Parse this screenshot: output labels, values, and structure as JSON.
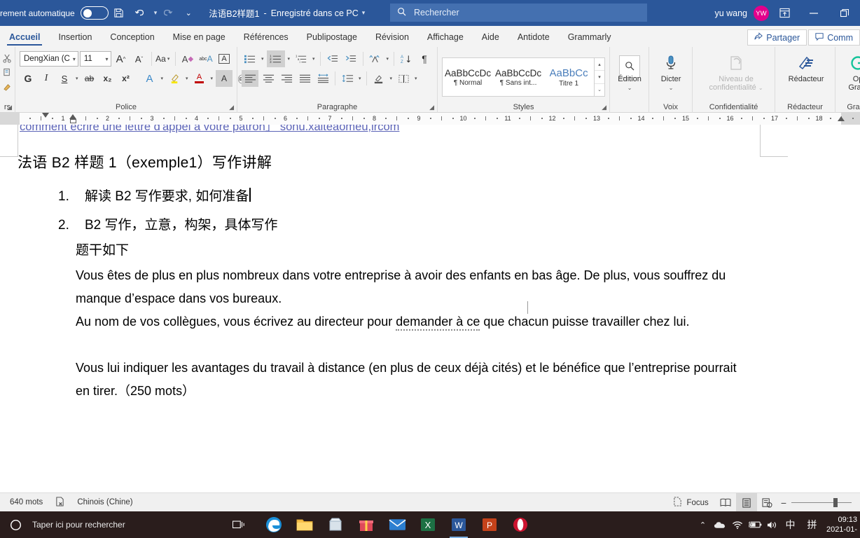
{
  "titlebar": {
    "autosave_label": "rement automatique",
    "autosave_state": "off",
    "save_icon": "save-icon",
    "undo_icon": "undo-icon",
    "redo_icon": "redo-icon",
    "customize_icon": "chevron-down-icon",
    "document_title": "法语B2样题1",
    "save_status": "Enregistré dans ce PC",
    "title_caret": "chevron-down-icon",
    "search_placeholder": "Rechercher",
    "search_icon": "search-icon",
    "user_name": "yu wang",
    "avatar_initials": "YW",
    "ribbon_display_icon": "ribbon-display-options-icon",
    "minimize_icon": "minimize-icon",
    "restore_icon": "restore-icon"
  },
  "tabs": [
    {
      "label": "Accueil",
      "active": true
    },
    {
      "label": "Insertion",
      "active": false
    },
    {
      "label": "Conception",
      "active": false
    },
    {
      "label": "Mise en page",
      "active": false
    },
    {
      "label": "Références",
      "active": false
    },
    {
      "label": "Publipostage",
      "active": false
    },
    {
      "label": "Révision",
      "active": false
    },
    {
      "label": "Affichage",
      "active": false
    },
    {
      "label": "Aide",
      "active": false
    },
    {
      "label": "Antidote",
      "active": false
    },
    {
      "label": "Grammarly",
      "active": false
    }
  ],
  "tab_actions": {
    "share_label": "Partager",
    "share_icon": "share-icon",
    "comments_label": "Comm",
    "comments_icon": "comment-icon"
  },
  "ribbon": {
    "clipboard": {
      "group_label": "rs",
      "launcher_icon": "dialog-launcher-icon",
      "cut_icon": "scissors-icon",
      "copy_icon": "copy-icon",
      "format_painter_icon": "format-painter-icon"
    },
    "font": {
      "group_label": "Police",
      "launcher_icon": "dialog-launcher-icon",
      "font_name": "DengXian (C",
      "font_size": "11",
      "grow_font_icon": "grow-font-icon",
      "shrink_font_icon": "shrink-font-icon",
      "change_case_label": "Aa",
      "clear_format_icon": "clear-formatting-icon",
      "phonetic_icon": "phonetic-guide-icon",
      "char_border_icon": "character-border-icon",
      "bold_label": "G",
      "italic_label": "I",
      "underline_label": "S",
      "strikethrough_label": "ab",
      "subscript_label": "x₂",
      "superscript_label": "x²",
      "text_effects_icon": "text-effects-icon",
      "highlight_icon": "highlight-icon",
      "font_color_icon": "font-color-icon",
      "char_shading_icon": "character-shading-icon",
      "enclose_char_icon": "enclose-character-icon"
    },
    "paragraph": {
      "group_label": "Paragraphe",
      "launcher_icon": "dialog-launcher-icon",
      "bullets_icon": "bullet-list-icon",
      "numbering_icon": "numbered-list-icon",
      "multilevel_icon": "multilevel-list-icon",
      "decrease_indent_icon": "decrease-indent-icon",
      "increase_indent_icon": "increase-indent-icon",
      "sort_cn_icon": "sort-phonetic-icon",
      "sort_icon": "sort-az-icon",
      "show_marks_icon": "pilcrow-icon",
      "align_left_icon": "align-left-icon",
      "align_center_icon": "align-center-icon",
      "align_right_icon": "align-right-icon",
      "justify_icon": "align-justify-icon",
      "distribute_icon": "distribute-text-icon",
      "line_spacing_icon": "line-spacing-icon",
      "shading_icon": "shading-icon",
      "borders_icon": "borders-icon"
    },
    "styles": {
      "group_label": "Styles",
      "launcher_icon": "dialog-launcher-icon",
      "items": [
        {
          "preview": "AaBbCcDc",
          "name": "¶ Normal"
        },
        {
          "preview": "AaBbCcDc",
          "name": "¶ Sans int..."
        },
        {
          "preview": "AaBbCc",
          "name": "Titre 1"
        }
      ],
      "scroll_up_icon": "chevron-up-icon",
      "scroll_down_icon": "chevron-down-icon",
      "more_icon": "styles-more-icon"
    },
    "editing": {
      "label": "Édition",
      "icon": "search-icon",
      "caret": "chevron-down-icon"
    },
    "voice": {
      "group_label": "Voix",
      "dictate_label": "Dicter",
      "dictate_icon": "microphone-icon",
      "caret": "chevron-down-icon"
    },
    "sensitivity": {
      "group_label": "Confidentialité",
      "label_line1": "Niveau de",
      "label_line2": "confidentialité",
      "icon": "sensitivity-label-icon",
      "disabled": true
    },
    "editor": {
      "group_label": "Rédacteur",
      "label": "Rédacteur",
      "icon": "editor-pen-icon"
    },
    "grammarly": {
      "group_label": "Gram",
      "label_line1": "Op",
      "label_line2": "Gram",
      "icon": "grammarly-icon"
    }
  },
  "ruler": {
    "unit_marks": [
      "1",
      "2",
      "3",
      "4",
      "5",
      "6",
      "7",
      "8",
      "9",
      "10",
      "11",
      "12",
      "13",
      "14",
      "15",
      "16",
      "17",
      "18"
    ],
    "left_indent_marker": "first-line-indent-marker",
    "right_indent_marker": "right-indent-marker"
  },
  "document": {
    "clipped_header_text": "comment écrire une lettre d'appel à votre patron」 sohu.xaiteaomeu,ircom",
    "title": "法语 B2 样题 1（exemple1）写作讲解",
    "list": [
      {
        "num": "1.",
        "text": "解读 B2 写作要求, 如何准备",
        "has_caret": true
      },
      {
        "num": "2.",
        "text": "B2 写作，立意，构架，具体写作",
        "has_caret": false
      }
    ],
    "subline": "题干如下",
    "paragraphs": [
      {
        "id": "p1",
        "before": "Vous êtes de plus en plus nombreux dans votre entreprise à avoir des enfants en bas âge. De plus, vous souffrez du manque d’espace dans vos bureaux.",
        "marked": "",
        "after": ""
      },
      {
        "id": "p2",
        "before": "Au nom de vos collègues, vous écrivez au directeur pour ",
        "marked": "demander à ce",
        "after": " que chacun puisse travailler chez lui."
      },
      {
        "id": "p3",
        "before": "Vous lui indiquer les avantages du travail à distance (en plus de ceux déjà cités) et le bénéfice que l’entreprise pourrait en tirer.（250 mots）",
        "marked": "",
        "after": ""
      }
    ]
  },
  "statusbar": {
    "page_partial": "",
    "word_count": "640 mots",
    "proofing_icon": "proofing-errors-icon",
    "language": "Chinois (Chine)",
    "focus_label": "Focus",
    "focus_icon": "focus-mode-icon",
    "read_mode_icon": "read-mode-icon",
    "print_layout_icon": "print-layout-icon",
    "web_layout_icon": "web-layout-icon",
    "zoom_out_icon": "zoom-out-icon",
    "zoom_in_icon": "zoom-in-icon"
  },
  "taskbar": {
    "start_icon": "cortana-circle-icon",
    "search_placeholder": "Taper ici pour rechercher",
    "search_icon": "search-icon",
    "task_view_icon": "task-view-icon",
    "apps": [
      {
        "name": "edge-icon",
        "color": "#2d8cd6",
        "glyph": "e",
        "active": false
      },
      {
        "name": "file-explorer-icon",
        "color": "#f7c04a",
        "glyph": "▤",
        "active": false
      },
      {
        "name": "microsoft-store-icon",
        "color": "#c9d4dd",
        "glyph": "▥",
        "active": false
      },
      {
        "name": "gift-app-icon",
        "color": "#e04a5a",
        "glyph": "🎁",
        "active": false
      },
      {
        "name": "mail-icon",
        "color": "#2c7fd0",
        "glyph": "✉",
        "active": false
      },
      {
        "name": "excel-icon",
        "color": "#1d7044",
        "glyph": "X",
        "active": false
      },
      {
        "name": "word-icon",
        "color": "#2b579a",
        "glyph": "W",
        "active": true
      },
      {
        "name": "powerpoint-icon",
        "color": "#c4421a",
        "glyph": "P",
        "active": false
      },
      {
        "name": "opera-icon",
        "color": "#cc1430",
        "glyph": "O",
        "active": false
      }
    ],
    "tray": {
      "show_hidden_icon": "chevron-up-icon",
      "onedrive_icon": "onedrive-cloud-icon",
      "network_icon": "wifi-icon",
      "battery_charge_icon": "battery-charging-icon",
      "volume_icon": "volume-icon",
      "ime_mode": "中",
      "ime_pinyin": "拼",
      "time": "09:13",
      "date": "2021-01-"
    }
  }
}
